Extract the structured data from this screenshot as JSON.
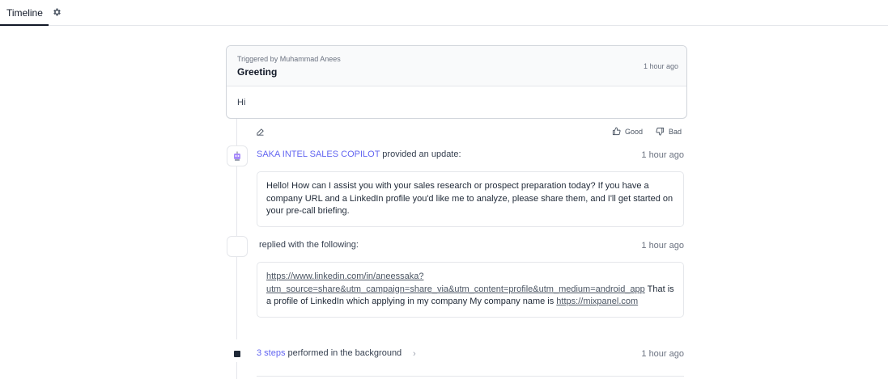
{
  "header": {
    "tab_label": "Timeline",
    "settings_icon": "gear-icon"
  },
  "trigger_card": {
    "triggered_by": "Triggered by Muhammad Anees",
    "title": "Greeting",
    "time": "1 hour ago",
    "body": "Hi"
  },
  "feedback": {
    "good_label": "Good",
    "bad_label": "Bad"
  },
  "events": [
    {
      "actor": "SAKA INTEL SALES COPILOT",
      "action": "provided an update:",
      "time": "1 hour ago",
      "message": "Hello! How can I assist you with your sales research or prospect preparation today? If you have a company URL and a LinkedIn profile you'd like me to analyze, please share them, and I'll get started on your pre-call briefing."
    },
    {
      "action": "replied with the following:",
      "time": "1 hour ago",
      "link1_line1": "https://www.linkedin.com/in/aneessaka?",
      "link1_line2": "utm_source=share&utm_campaign=share_via&utm_content=profile&utm_medium=android_app",
      "text_mid": " That is a profile of LinkedIn which applying in my company My company name is ",
      "link2": "https://mixpanel.com"
    },
    {
      "steps_label": "3 steps",
      "action": "performed in the background",
      "time": "1 hour ago"
    }
  ],
  "colors": {
    "accent": "#6366f1",
    "text": "#1f2937",
    "muted": "#6b7280",
    "border": "#e5e7eb"
  }
}
